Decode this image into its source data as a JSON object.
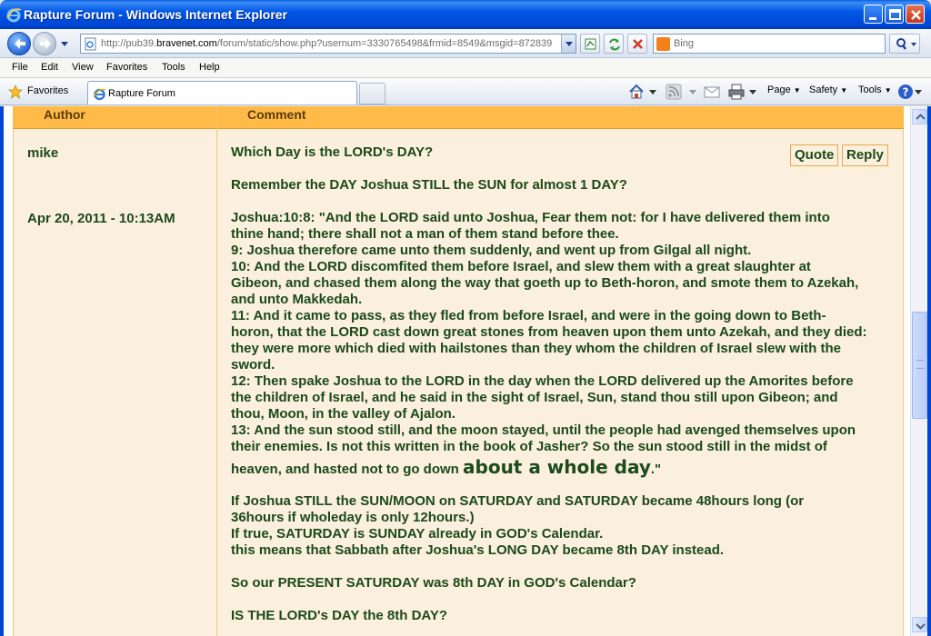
{
  "window": {
    "title": "Rapture Forum - Windows Internet Explorer"
  },
  "address_bar": {
    "url_prefix": "http://pub39.",
    "url_domain": "bravenet.com",
    "url_rest": "/forum/static/show.php?usernum=3330765498&frmid=8549&msgid=872839",
    "search_placeholder": "Bing"
  },
  "menu": [
    "File",
    "Edit",
    "View",
    "Favorites",
    "Tools",
    "Help"
  ],
  "favorites_bar": {
    "favorites_label": "Favorites",
    "tab_label": "Rapture Forum",
    "commands": [
      "Page",
      "Safety",
      "Tools"
    ]
  },
  "forum": {
    "header": {
      "author": "Author",
      "comment": "Comment"
    },
    "post": {
      "author": "mike",
      "date": "Apr 20, 2011 - 10:13AM",
      "quote_label": "Quote",
      "reply_label": "Reply",
      "lines": [
        "Which Day is the LORD's DAY?",
        "Remember the DAY Joshua STILL the SUN for almost 1 DAY?",
        "Joshua:10:8: \"And the LORD said unto Joshua, Fear them not: for I have delivered them into",
        "thine hand; there shall not a man of them stand before thee.",
        "9: Joshua therefore came unto them suddenly, and went up from Gilgal all night.",
        "10: And the LORD discomfited them before Israel, and slew them with a great slaughter at",
        "Gibeon, and chased them along the way that goeth up to Beth-horon, and smote them to Azekah,",
        "and unto Makkedah.",
        "11: And it came to pass, as they fled from before Israel, and were in the going down to Beth-",
        "horon, that the LORD cast down great stones from heaven upon them unto Azekah, and they died:",
        "they were more which died with hailstones than they whom the children of Israel slew with the",
        "sword.",
        "12: Then spake Joshua to the LORD in the day when the LORD delivered up the Amorites before",
        "the children of Israel, and he said in the sight of Israel, Sun, stand thou still upon Gibeon; and",
        "thou, Moon, in the valley of Ajalon.",
        "13: And the sun stood still, and the moon stayed, until the people had avenged themselves upon",
        "their enemies. Is not this written in the book of Jasher? So the sun stood still in the midst of"
      ],
      "line_last_prefix": "heaven, and hasted not to go down ",
      "line_last_big": "about a whole day",
      "line_last_suffix": ".\"",
      "after_lines": [
        "If Joshua STILL the SUN/MOON on SATURDAY and SATURDAY became 48hours long (or",
        "36hours if wholeday is only 12hours.)",
        "If true, SATURDAY is SUNDAY already in GOD's Calendar.",
        "this means that Sabbath after Joshua's LONG DAY became 8th DAY instead.",
        "So our PRESENT SATURDAY was 8th DAY in GOD's Calendar?",
        "IS THE LORD's DAY the 8th DAY?"
      ]
    }
  },
  "colors": {
    "header_bg": "#ffba48",
    "post_bg": "#fbefdd",
    "text": "#1b4a1b",
    "titlebar": "#0058e6"
  },
  "icons": [
    "ie-icon",
    "back-arrow-icon",
    "forward-arrow-icon",
    "page-icon",
    "compatibility-icon",
    "refresh-icon",
    "stop-icon",
    "bing-icon",
    "search-icon",
    "favorites-star-icon",
    "home-icon",
    "feeds-icon",
    "mail-icon",
    "print-icon",
    "help-icon"
  ]
}
